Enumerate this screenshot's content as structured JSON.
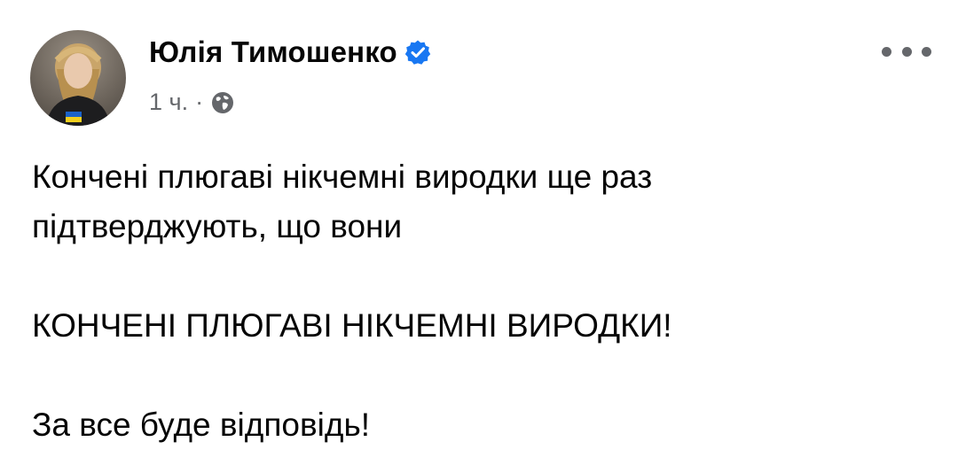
{
  "post": {
    "author": {
      "name": "Юлія Тимошенко",
      "verified": true,
      "avatar_icon": "profile-photo"
    },
    "meta": {
      "time": "1 ч.",
      "separator": "·",
      "audience_icon": "globe-icon"
    },
    "more_icon": "more-horizontal-icon",
    "paragraphs": [
      "Кончені плюгаві нікчемні виродки ще раз\nпідтверджують, що вони",
      "КОНЧЕНІ ПЛЮГАВІ НІКЧЕМНІ ВИРОДКИ!",
      "За все буде відповідь!"
    ],
    "colors": {
      "text": "#050505",
      "secondary": "#65676b",
      "verified_badge": "#1877f2"
    }
  }
}
